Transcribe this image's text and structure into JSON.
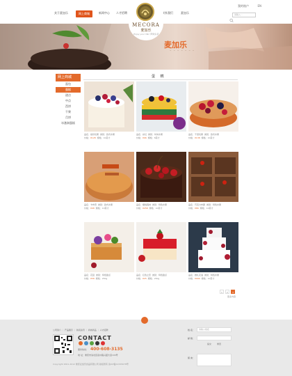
{
  "header": {
    "nav_left": [
      "关于麦加乐",
      "网上商城",
      "新闻中心",
      "人才招聘"
    ],
    "nav_right": [
      "联系我们",
      "麦加乐"
    ],
    "account": "我的账户",
    "lang": "EN",
    "search_placeholder": "请输入..."
  },
  "logo": {
    "name": "MECORA",
    "cn": "麦加乐",
    "slogan": "Enjoy your life! 享受生活"
  },
  "banner": {
    "title": "麦加乐",
    "subtitle": "~ ~ ~ ~ ~ ~ ~"
  },
  "sidebar": {
    "heading": "网上商城",
    "items": [
      "面包",
      "蛋糕",
      "甜点",
      "中点",
      "西饼",
      "干果",
      "月饼",
      "冰激淋蛋糕"
    ],
    "selected": 1
  },
  "section": {
    "title": "蛋 糕"
  },
  "products": [
    {
      "name": "缤纷莓果",
      "category": "欧式水果",
      "price": "¥128",
      "size": "10英寸"
    },
    {
      "name": "彩虹",
      "category": "时尚水果",
      "price": "¥96",
      "size": "8英寸"
    },
    {
      "name": "千层莓果",
      "category": "欧式水果",
      "price": "¥138",
      "size": "10英寸"
    },
    {
      "name": "卡布奇",
      "category": "欧式水果",
      "price": "¥98",
      "size": "10英寸"
    },
    {
      "name": "樱桃森林",
      "category": "特色水果",
      "price": "¥258",
      "size": "10英寸"
    },
    {
      "name": "巧克力布朗",
      "category": "特色水果",
      "price": "¥86",
      "size": "10英寸"
    },
    {
      "name": "花园",
      "category": "特色甜点",
      "price": "¥58",
      "size": "250g"
    },
    {
      "name": "红色之恋",
      "category": "特色甜点",
      "price": "¥25",
      "size": "250g"
    },
    {
      "name": "婚礼花语",
      "category": "特色水果",
      "price": "¥999",
      "size": "10英寸"
    }
  ],
  "meta_labels": {
    "name": "品名：",
    "category": "类别：",
    "price": "价格：",
    "size": "规格："
  },
  "pager": {
    "pages": [
      "1",
      "2",
      "3"
    ],
    "current": 2,
    "more": "更多内容"
  },
  "footer": {
    "links": "公司简介 ｜ 产品展示 ｜ 新闻资讯 ｜ 商城商品 ｜ 人才招聘",
    "contact_title": "CONTACT",
    "hotline_label": "服务热线：",
    "hotline": "400-608-3135",
    "address": "地 址：重庆市渝北区嘉州路兴盛大道100号",
    "copyright": "Copyright 2001-2012 重庆麦加乐食品有限公司 版权所有 渝ICP备12345678号",
    "form": {
      "name_label": "姓 名：",
      "name_placeholder": "请输入姓名",
      "email_label": "邮 箱：",
      "message_label": "留 言：",
      "submit": "提交",
      "reset": "重置"
    }
  },
  "colors": {
    "accent": "#e36a2b",
    "footer_bg": "#e9e9e9"
  }
}
